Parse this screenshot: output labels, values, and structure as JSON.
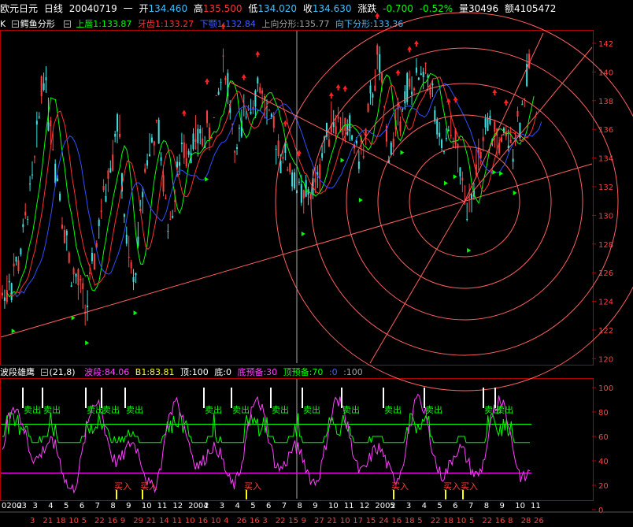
{
  "header": {
    "name": "欧元日元",
    "period": "日线",
    "date": "20040719",
    "weekday": "一",
    "open_label": "开",
    "open": "134.460",
    "high_label": "高",
    "high": "135.500",
    "low_label": "低",
    "low": "134.020",
    "close_label": "收",
    "close": "134.630",
    "change_label": "涨跌",
    "change": "-0.700",
    "change_pct": "-0.52%",
    "vol_label": "量",
    "vol": "30496",
    "amt_label": "额",
    "amt": "4105472"
  },
  "indicator1": {
    "prefix": "K",
    "name": "鳄鱼分形",
    "lip": "上唇1:133.87",
    "teeth": "牙齿1:133.27",
    "jaw": "下颚1:132.84",
    "up_fractal": "上向分形:135.77",
    "down_fractal": "向下分形:133.36"
  },
  "indicator2": {
    "name": "波段雄鹰",
    "params": "(21,8)",
    "wave": "波段:84.06",
    "b1": "B1:83.81",
    "top": "顶:100",
    "bottom": "底:0",
    "bottom_warn": "底预备:30",
    "top_warn": "顶预备:70",
    "v1": ":0",
    "v2": ":100"
  },
  "price_axis": [
    "142",
    "140",
    "138",
    "136",
    "134",
    "132",
    "130",
    "128",
    "126",
    "124",
    "122",
    "120"
  ],
  "osc_axis": [
    "100",
    "80",
    "60",
    "40",
    "20",
    "0"
  ],
  "osc_labels": {
    "sell": "卖出",
    "buy": "买入"
  },
  "time_axis_top": [
    "02003",
    "2",
    "3",
    "4",
    "5",
    "6",
    "7",
    "8",
    "9",
    "10",
    "11",
    "12",
    "2004",
    "2",
    "3",
    "4",
    "5",
    "6",
    "7",
    "8",
    "9",
    "10",
    "11",
    "12",
    "2005",
    "2",
    "3",
    "4",
    "5",
    "6",
    "7",
    "8",
    "9",
    "10",
    "11"
  ],
  "time_axis_bottom": [
    "3",
    "21",
    "18",
    "10",
    "5",
    "22",
    "16",
    "9",
    "29",
    "21",
    "14",
    "11",
    "10",
    "16",
    "10",
    "4",
    "26",
    "16",
    "3",
    "22",
    "15",
    "9",
    "27",
    "21",
    "10",
    "17",
    "15",
    "24",
    "16",
    "18",
    "5",
    "22",
    "18",
    "10",
    "5",
    "22",
    "16",
    "8",
    "28",
    "26"
  ],
  "colors": {
    "bg": "#000000",
    "frame": "#b00000",
    "up_arrow": "#ff2020",
    "down_arrow": "#00ff00",
    "circle": "#ff6060",
    "lip": "#00ff00",
    "teeth": "#ff3030",
    "jaw": "#3050ff"
  }
}
